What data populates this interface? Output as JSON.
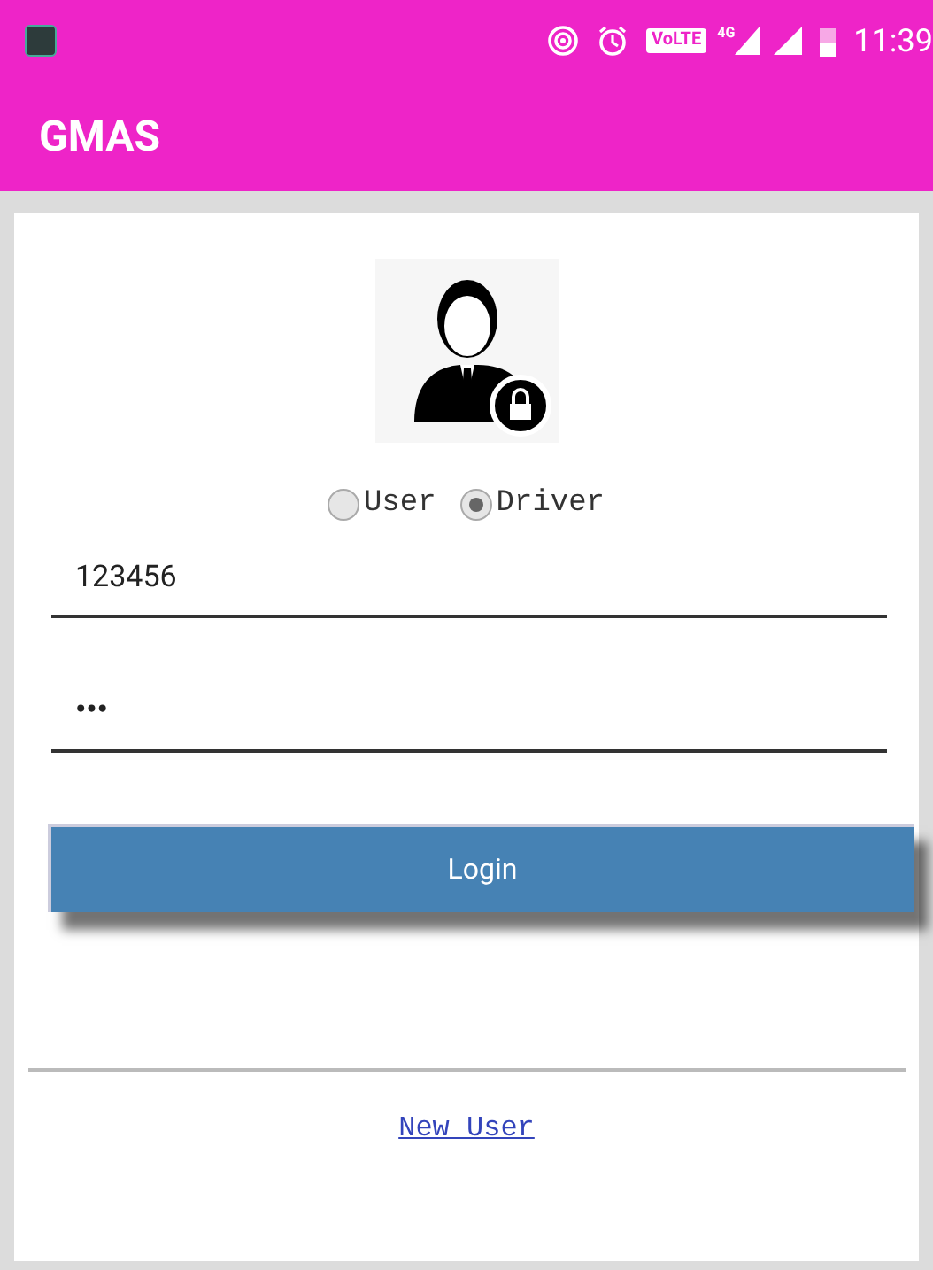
{
  "status_bar": {
    "volte": "VoLTE",
    "network": "4G",
    "time": "11:39"
  },
  "app_bar": {
    "title": "GMAS"
  },
  "login": {
    "roles": [
      {
        "label": "User",
        "selected": false
      },
      {
        "label": "Driver",
        "selected": true
      }
    ],
    "username": {
      "value": "123456"
    },
    "password": {
      "value": "•••"
    },
    "button": "Login",
    "link": "New User"
  }
}
